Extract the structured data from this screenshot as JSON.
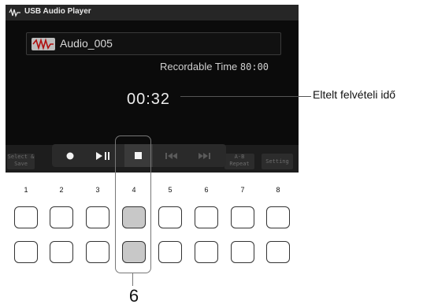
{
  "window": {
    "title": "USB Audio Player",
    "icon": "usb-audio-icon"
  },
  "file": {
    "icon": "audio-wave-icon",
    "name": "Audio_005"
  },
  "recordable": {
    "label": "Recordable Time",
    "value": "80:00"
  },
  "elapsed_time": "00:32",
  "side_buttons": {
    "select_save": {
      "line1": "Select &",
      "line2": "Save"
    },
    "ab_repeat": {
      "line1": "A-B",
      "line2": "Repeat"
    },
    "setting": {
      "line1": "Setting"
    }
  },
  "transport": [
    {
      "icon": "record-icon",
      "enabled": true
    },
    {
      "icon": "play-pause-icon",
      "enabled": true
    },
    {
      "icon": "stop-icon",
      "enabled": true,
      "active": true
    },
    {
      "icon": "rewind-icon",
      "enabled": false
    },
    {
      "icon": "fast-forward-icon",
      "enabled": false
    }
  ],
  "callout": {
    "text": "Eltelt felvételi idő"
  },
  "button_numbers": [
    "1",
    "2",
    "3",
    "4",
    "5",
    "6",
    "7",
    "8"
  ],
  "pressed_button": "4",
  "annotation_number": "6",
  "colors": {
    "screen_bg": "#0b0b0b",
    "titlebar_bg": "#262626",
    "pressed_button_fill": "#c8c8c8"
  }
}
